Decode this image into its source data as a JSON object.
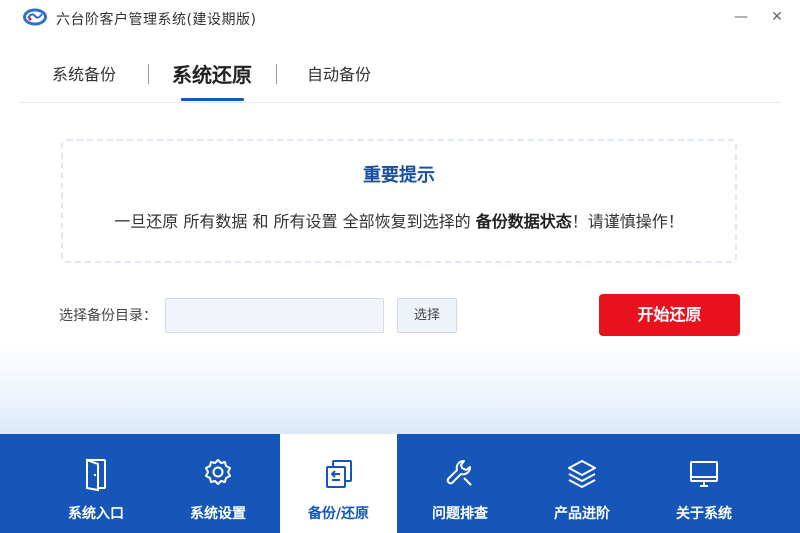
{
  "app": {
    "title": "六台阶客户管理系统(建设期版)",
    "minimize": "—",
    "close": "✕"
  },
  "tabs": {
    "backup": "系统备份",
    "restore": "系统还原",
    "auto": "自动备份"
  },
  "notice": {
    "title": "重要提示",
    "text_pre": "一旦还原 所有数据 和 所有设置 全部恢复到选择的 ",
    "text_bold": "备份数据状态",
    "text_post": "！请谨慎操作！"
  },
  "restore": {
    "dir_label": "选择备份目录：",
    "dir_value": "",
    "choose_label": "选择",
    "start_label": "开始还原"
  },
  "nav": [
    {
      "label": "系统入口",
      "icon": "door-icon"
    },
    {
      "label": "系统设置",
      "icon": "gear-icon"
    },
    {
      "label": "备份/还原",
      "icon": "backup-restore-icon"
    },
    {
      "label": "问题排查",
      "icon": "wrench-icon"
    },
    {
      "label": "产品进阶",
      "icon": "layers-icon"
    },
    {
      "label": "关于系统",
      "icon": "monitor-icon"
    }
  ],
  "colors": {
    "primary": "#1556b8",
    "danger": "#e8121e",
    "notice_title": "#1a4fa0"
  }
}
